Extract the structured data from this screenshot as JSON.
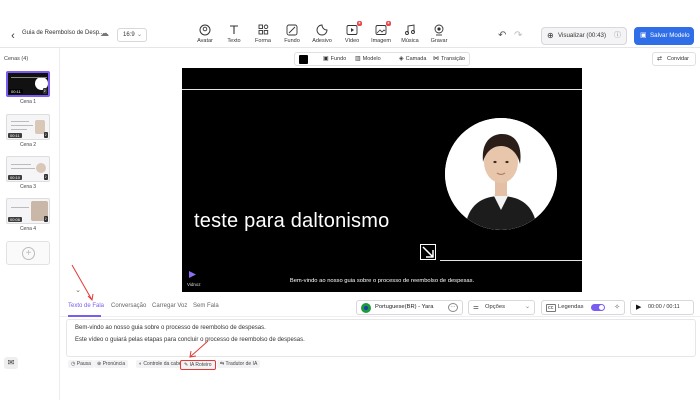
{
  "header": {
    "project_title": "Guia de Reembolso de Desp...",
    "aspect_ratio": "16:9",
    "tools": [
      {
        "label": "Avatar",
        "icon": "avatar-icon"
      },
      {
        "label": "Texto",
        "icon": "text-icon"
      },
      {
        "label": "Forma",
        "icon": "shape-icon"
      },
      {
        "label": "Fundo",
        "icon": "background-icon"
      },
      {
        "label": "Adesivo",
        "icon": "sticker-icon"
      },
      {
        "label": "Vídeo",
        "icon": "video-icon"
      },
      {
        "label": "Imagem",
        "icon": "image-icon"
      },
      {
        "label": "Música",
        "icon": "music-icon"
      },
      {
        "label": "Gravar",
        "icon": "record-icon"
      }
    ],
    "preview_label": "Visualizar (00:43)",
    "save_label": "Salvar Modelo"
  },
  "sidebar": {
    "title": "Cenas (4)",
    "scenes": [
      {
        "name": "Cena 1",
        "duration": "00:11"
      },
      {
        "name": "Cena 2",
        "duration": "00:11"
      },
      {
        "name": "Cena 3",
        "duration": "00:10"
      },
      {
        "name": "Cena 4",
        "duration": "00:06"
      }
    ]
  },
  "layer_bar": {
    "items": [
      "Fundo",
      "Modelo",
      "Camada",
      "Transição"
    ]
  },
  "replace_label": "Convidar",
  "canvas": {
    "headline": "teste para daltonismo",
    "subtitle": "Bem-vindo ao nosso guia sobre o processo de reembolso de despesas.",
    "logo_text": "Vidnoz"
  },
  "script_panel": {
    "tabs": [
      "Texto de Fala",
      "Conversação",
      "Carregar Voz",
      "Sem Fala"
    ],
    "active_tab": 0,
    "voice": "Portuguese(BR) - Yara",
    "options_label": "Opções",
    "captions_label": "Legendas",
    "captions_on": true,
    "playback_time": "00:00 / 00:11",
    "lines": [
      "Bem-vindo ao nosso guia sobre o processo de reembolso de despesas.",
      "Este vídeo o guiará pelas etapas para concluir o processo de reembolso de despesas."
    ],
    "tools": [
      "Pausa",
      "Pronúncia",
      "Controle da cabeça",
      "IA Roteiro",
      "Tradutor de IA"
    ]
  },
  "colors": {
    "accent": "#7a5cf0",
    "primary_button": "#2f6ee6",
    "annotation": "#e53935"
  }
}
